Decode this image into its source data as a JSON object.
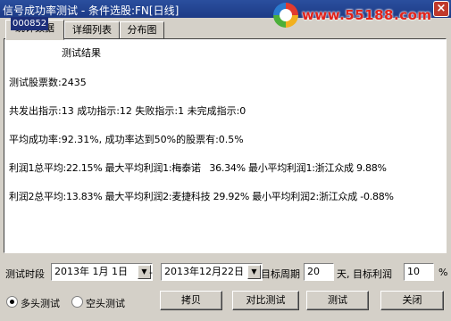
{
  "window": {
    "title": "信号成功率测试 - 条件选股:FN[日线]",
    "logo_text": "www.55188.com",
    "close_symbol": "×",
    "badge": "000852"
  },
  "tabs": [
    {
      "label": "统计数据"
    },
    {
      "label": "详细列表"
    },
    {
      "label": "分布图"
    }
  ],
  "results": {
    "heading": "测试结果",
    "lines": [
      "测试股票数:2435",
      "共发出指示:13 成功指示:12 失败指示:1 未完成指示:0",
      "平均成功率:92.31%, 成功率达到50%的股票有:0.5%",
      "利润1总平均:22.15% 最大平均利润1:梅泰诺   36.34% 最小平均利润1:浙江众成 9.88%",
      "利润2总平均:13.83% 最大平均利润2:麦捷科技 29.92% 最小平均利润2:浙江众成 -0.88%"
    ]
  },
  "controls": {
    "period_label": "测试时段",
    "start_date": "2013年 1月 1日",
    "separator": "-",
    "end_date": "2013年12月22日",
    "target_period_label": "目标周期",
    "target_period_value": "20",
    "target_profit_label": "天, 目标利润",
    "target_profit_value": "10",
    "percent_unit": "%",
    "dropdown_glyph": "▼",
    "radio_long": "多头测试",
    "radio_short": "空头测试",
    "radio_selected": "long",
    "btn_copy": "拷贝",
    "btn_compare": "对比测试",
    "btn_test": "测试",
    "btn_close": "关闭"
  }
}
